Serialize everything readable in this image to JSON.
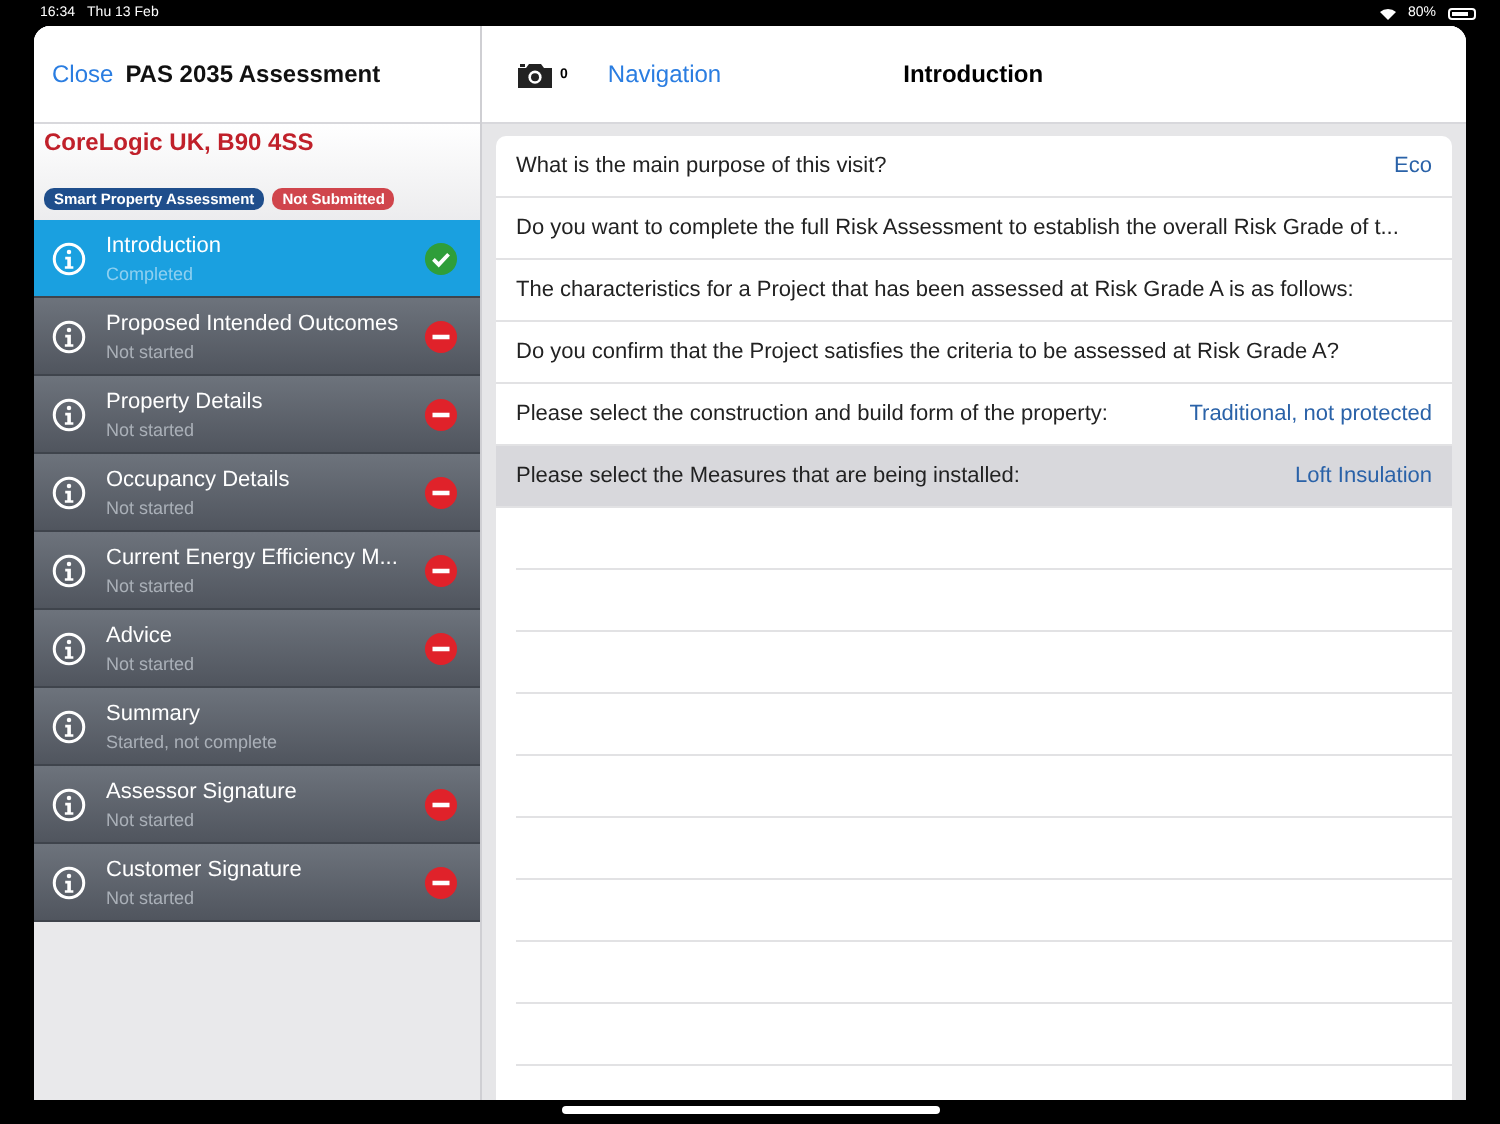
{
  "status_bar": {
    "time": "16:34",
    "date": "Thu 13 Feb",
    "battery": "80%"
  },
  "sidebar": {
    "close": "Close",
    "title": "PAS 2035 Assessment",
    "property": "CoreLogic UK, B90 4SS",
    "badges": [
      {
        "label": "Smart Property Assessment",
        "color": "#1f4e8c"
      },
      {
        "label": "Not Submitted",
        "color": "#d0454c"
      }
    ],
    "items": [
      {
        "label": "Introduction",
        "status": "Completed",
        "kind": "completed",
        "selected": true
      },
      {
        "label": "Proposed Intended Outcomes",
        "status": "Not started",
        "kind": "not_started",
        "selected": false
      },
      {
        "label": "Property Details",
        "status": "Not started",
        "kind": "not_started",
        "selected": false
      },
      {
        "label": "Occupancy Details",
        "status": "Not started",
        "kind": "not_started",
        "selected": false
      },
      {
        "label": "Current Energy Efficiency M...",
        "status": "Not started",
        "kind": "not_started",
        "selected": false
      },
      {
        "label": "Advice",
        "status": "Not started",
        "kind": "not_started",
        "selected": false
      },
      {
        "label": "Summary",
        "status": "Started, not complete",
        "kind": "in_progress",
        "selected": false
      },
      {
        "label": "Assessor Signature",
        "status": "Not started",
        "kind": "not_started",
        "selected": false
      },
      {
        "label": "Customer Signature",
        "status": "Not started",
        "kind": "not_started",
        "selected": false
      }
    ]
  },
  "toolbar": {
    "photo_count": "0",
    "navigation": "Navigation",
    "title": "Introduction"
  },
  "questions": [
    {
      "question": "What is the main purpose of this visit?",
      "answer": "Eco",
      "selected": false
    },
    {
      "question": "Do you want to complete the full Risk Assessment to establish the overall Risk Grade of t...",
      "selected": false
    },
    {
      "question": "The characteristics for a Project that has been assessed at Risk Grade A is as follows:",
      "selected": false
    },
    {
      "question": "Do you confirm that the Project satisfies the criteria to be assessed at Risk Grade A?",
      "selected": false
    },
    {
      "question": "Please select the construction and build form of the property:",
      "answer": "Traditional, not protected",
      "selected": false
    },
    {
      "question": "Please select the Measures that are being installed:",
      "answer": "Loft Insulation",
      "selected": true
    }
  ]
}
